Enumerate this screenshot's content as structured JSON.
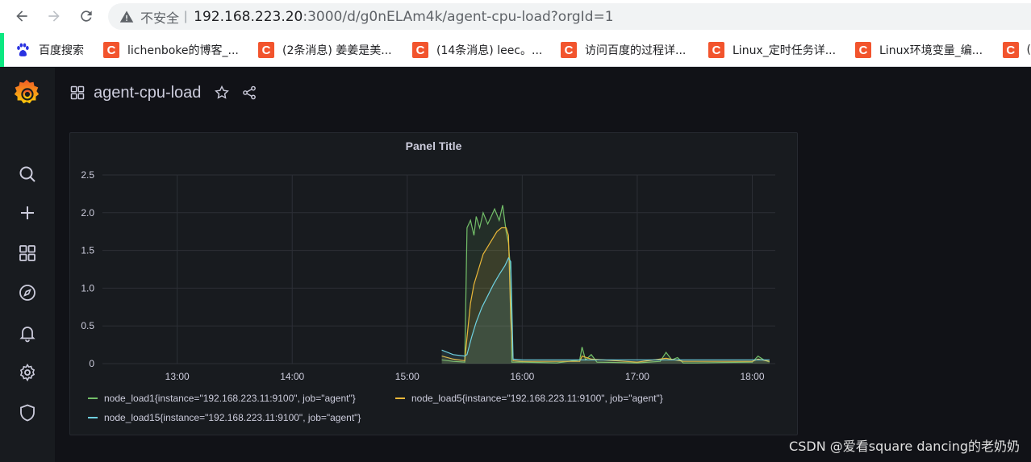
{
  "browser": {
    "security_label": "不安全",
    "separator": "|",
    "url_host": "192.168.223.20",
    "url_rest": ":3000/d/g0nELAm4k/agent-cpu-load?orgId=1"
  },
  "bookmarks": [
    {
      "label": "百度搜索",
      "icon": "baidu-paw-icon"
    },
    {
      "label": "lichenboke的博客_...",
      "icon": "csdn-icon"
    },
    {
      "label": "(2条消息) 姜姜是美...",
      "icon": "csdn-icon"
    },
    {
      "label": "(14条消息) leec。...",
      "icon": "csdn-icon"
    },
    {
      "label": "访问百度的过程详...",
      "icon": "csdn-icon"
    },
    {
      "label": "Linux_定时任务详...",
      "icon": "csdn-icon"
    },
    {
      "label": "Linux环境变量_编...",
      "icon": "csdn-icon"
    },
    {
      "label": "(",
      "icon": "csdn-icon"
    }
  ],
  "dashboard": {
    "title": "agent-cpu-load"
  },
  "colors": {
    "load1": "#73bf69",
    "load5": "#eab839",
    "load15": "#6ed0e0",
    "grid": "#2c2f36",
    "text": "#ccccdc"
  },
  "chart_data": {
    "type": "line",
    "title": "Panel Title",
    "x_ticks": [
      "13:00",
      "14:00",
      "15:00",
      "16:00",
      "17:00",
      "18:00"
    ],
    "y_ticks": [
      "0",
      "0.5",
      "1.0",
      "1.5",
      "2.0",
      "2.5"
    ],
    "ylim": [
      0,
      2.5
    ],
    "xlim_hours": [
      12.35,
      18.2
    ],
    "series": [
      {
        "name": "node_load1{instance=\"192.168.223.11:9100\", job=\"agent\"}",
        "color": "#73bf69",
        "points": [
          [
            15.3,
            0.05
          ],
          [
            15.4,
            0.03
          ],
          [
            15.5,
            0.02
          ],
          [
            15.52,
            1.8
          ],
          [
            15.55,
            1.9
          ],
          [
            15.58,
            1.7
          ],
          [
            15.6,
            1.95
          ],
          [
            15.63,
            1.8
          ],
          [
            15.66,
            2.0
          ],
          [
            15.7,
            1.85
          ],
          [
            15.73,
            1.95
          ],
          [
            15.76,
            2.05
          ],
          [
            15.8,
            1.9
          ],
          [
            15.83,
            2.1
          ],
          [
            15.86,
            1.75
          ],
          [
            15.88,
            1.6
          ],
          [
            15.9,
            1.2
          ],
          [
            15.91,
            0.02
          ],
          [
            15.93,
            0.02
          ],
          [
            16.0,
            0.02
          ],
          [
            16.3,
            0.01
          ],
          [
            16.5,
            0.05
          ],
          [
            16.52,
            0.22
          ],
          [
            16.55,
            0.05
          ],
          [
            16.6,
            0.12
          ],
          [
            16.65,
            0.02
          ],
          [
            17.0,
            0.01
          ],
          [
            17.2,
            0.03
          ],
          [
            17.25,
            0.15
          ],
          [
            17.3,
            0.05
          ],
          [
            17.35,
            0.08
          ],
          [
            17.4,
            0.01
          ],
          [
            17.5,
            0.01
          ],
          [
            18.0,
            0.02
          ],
          [
            18.05,
            0.1
          ],
          [
            18.1,
            0.05
          ],
          [
            18.15,
            0.02
          ]
        ]
      },
      {
        "name": "node_load5{instance=\"192.168.223.11:9100\", job=\"agent\"}",
        "color": "#eab839",
        "points": [
          [
            15.3,
            0.1
          ],
          [
            15.4,
            0.06
          ],
          [
            15.5,
            0.04
          ],
          [
            15.52,
            0.35
          ],
          [
            15.55,
            0.8
          ],
          [
            15.58,
            1.05
          ],
          [
            15.62,
            1.25
          ],
          [
            15.66,
            1.45
          ],
          [
            15.7,
            1.55
          ],
          [
            15.74,
            1.65
          ],
          [
            15.78,
            1.75
          ],
          [
            15.82,
            1.8
          ],
          [
            15.86,
            1.8
          ],
          [
            15.88,
            1.7
          ],
          [
            15.9,
            0.6
          ],
          [
            15.92,
            0.04
          ],
          [
            16.0,
            0.03
          ],
          [
            16.5,
            0.03
          ],
          [
            16.52,
            0.1
          ],
          [
            16.6,
            0.06
          ],
          [
            17.0,
            0.02
          ],
          [
            17.25,
            0.07
          ],
          [
            17.4,
            0.03
          ],
          [
            18.0,
            0.03
          ],
          [
            18.05,
            0.06
          ],
          [
            18.15,
            0.03
          ]
        ]
      },
      {
        "name": "node_load15{instance=\"192.168.223.11:9100\", job=\"agent\"}",
        "color": "#6ed0e0",
        "points": [
          [
            15.3,
            0.18
          ],
          [
            15.4,
            0.12
          ],
          [
            15.5,
            0.1
          ],
          [
            15.52,
            0.12
          ],
          [
            15.56,
            0.35
          ],
          [
            15.6,
            0.55
          ],
          [
            15.65,
            0.75
          ],
          [
            15.7,
            0.9
          ],
          [
            15.75,
            1.05
          ],
          [
            15.8,
            1.18
          ],
          [
            15.85,
            1.3
          ],
          [
            15.88,
            1.4
          ],
          [
            15.9,
            1.35
          ],
          [
            15.92,
            0.06
          ],
          [
            16.0,
            0.05
          ],
          [
            16.5,
            0.05
          ],
          [
            17.0,
            0.05
          ],
          [
            17.5,
            0.05
          ],
          [
            18.0,
            0.05
          ],
          [
            18.15,
            0.05
          ]
        ]
      }
    ],
    "legend_position": "bottom"
  },
  "watermark": "CSDN @爱看square dancing的老奶奶"
}
